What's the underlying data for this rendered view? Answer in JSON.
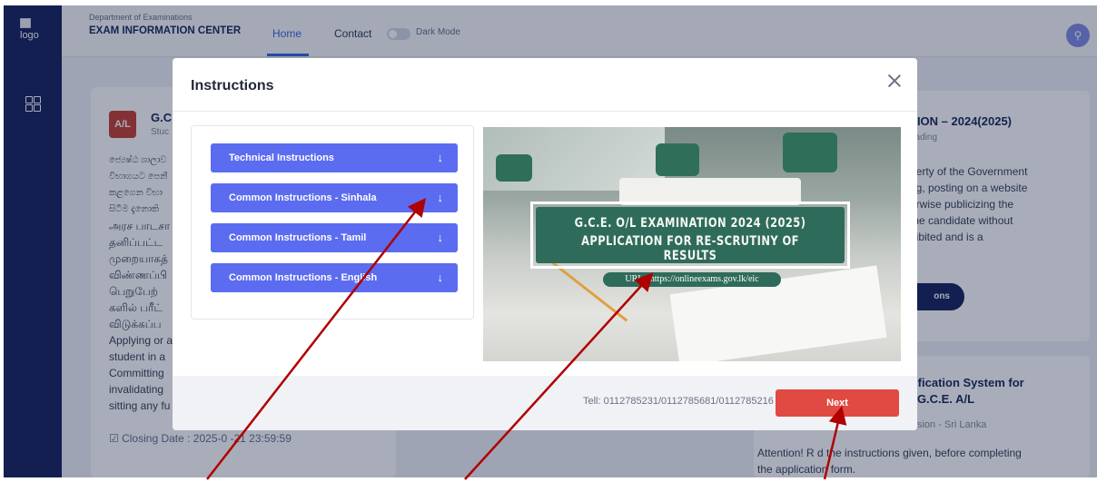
{
  "header": {
    "logo_alt": "logo",
    "department": "Department of Examinations",
    "center": "EXAM INFORMATION CENTER",
    "nav": {
      "home": "Home",
      "contact": "Contact"
    },
    "dark_mode_label": "Dark Mode",
    "dark_mode_on": false
  },
  "background": {
    "card_left": {
      "badge": "A/L",
      "title": "G.C",
      "sub": "Stuc",
      "lines": [
        "ජ්‍යෙෂ්ඨ ශාලාව",
        "විභාගයට පෙනී",
        "කළගෙන විභා",
        "සිටීම දැනොකි",
        "அரச பாடசா",
        "தனிப்பட்ட",
        "முறையாகத்",
        "விண்ணப்பி",
        "பெறுபேற்",
        "களில் பரீட்",
        "விடுக்கப்ப",
        "Applying or a",
        "student in a",
        "Committing",
        "invalidating",
        "sitting any fu"
      ],
      "closing": "Closing Date : 2025-0 -21 23:59:59"
    },
    "card_right_top": {
      "title": "TION – 2024(2025)",
      "sub": "oading",
      "lines": [
        "perty of the Government",
        "ng, posting on a website",
        "erwise publicizing the",
        "the candidate without",
        "hibited and is a"
      ],
      "button": "ons"
    },
    "card_right_bottom": {
      "title_l1": "rification System for",
      "title_l2": "f G.C.E. A/L",
      "sub": "ission - Sri Lanka",
      "note_l1": "Attention! R  d the instructions given, before completing",
      "note_l2": "the application form."
    }
  },
  "modal": {
    "title": "Instructions",
    "accordion": [
      {
        "label": "Technical Instructions"
      },
      {
        "label": "Common Instructions - Sinhala"
      },
      {
        "label": "Common Instructions - Tamil"
      },
      {
        "label": "Common Instructions - English"
      }
    ],
    "banner_line1": "G.C.E. O/L EXAMINATION 2024 (2025)",
    "banner_line2": "APPLICATION FOR RE-SCRUTINY OF RESULTS",
    "url_text": "URL : https://onlineexams.gov.lk/eic",
    "tel": "Tell: 0112785231/0112785681/0112785216",
    "next_label": "Next"
  },
  "icons": {
    "close": "close-icon",
    "arrow_down": "arrow-down-icon",
    "grid": "grid-icon",
    "user": "user-icon",
    "calendar": "calendar-check-icon"
  },
  "colors": {
    "sidebar": "#0c1b56",
    "accordion_button": "#5b6cf0",
    "next_button": "#e04a42",
    "annotation_arrow": "#b00000",
    "banner": "#2f6b5a"
  }
}
